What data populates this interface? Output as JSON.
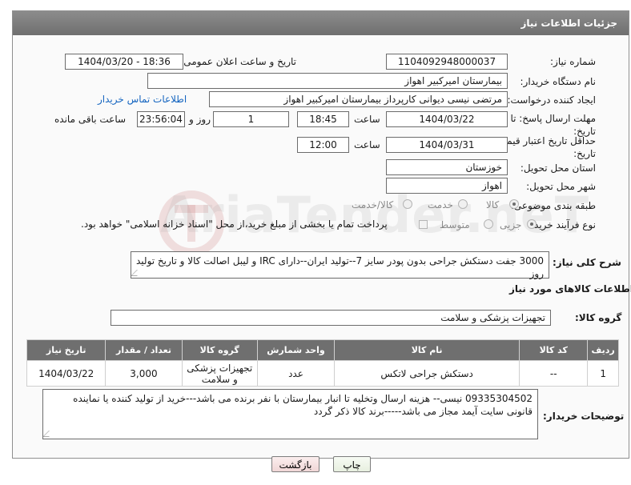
{
  "header": {
    "title": "جزئیات اطلاعات نیاز"
  },
  "watermark": {
    "text": "AriaTender.neT"
  },
  "fields": {
    "need_number": {
      "label": "شماره نیاز:",
      "value": "1104092948000037"
    },
    "announce_datetime": {
      "label": "تاریخ و ساعت اعلان عمومی:",
      "value": "1404/03/20 - 18:36"
    },
    "buyer_org": {
      "label": "نام دستگاه خریدار:",
      "value": "بیمارستان امیرکبیر اهواز"
    },
    "requester": {
      "label": "ایجاد کننده درخواست:",
      "value": "مرتضی نیسی دیوانی کارپرداز بیمارستان امیرکبیر اهواز",
      "contact_link": "اطلاعات تماس خریدار"
    },
    "reply_deadline": {
      "label": "مهلت ارسال پاسخ: تا تاریخ:",
      "date": "1404/03/22",
      "time_label": "ساعت",
      "time": "18:45",
      "days": "1",
      "days_label": "روز و",
      "remaining": "23:56:04",
      "remaining_label": "ساعت باقی مانده"
    },
    "price_validity": {
      "label": "حداقل تاریخ اعتبار قیمت: تا تاریخ:",
      "date": "1404/03/31",
      "time_label": "ساعت",
      "time": "12:00"
    },
    "delivery_province": {
      "label": "استان محل تحویل:",
      "value": "خوزستان"
    },
    "delivery_city": {
      "label": "شهر محل تحویل:",
      "value": "اهواز"
    },
    "category": {
      "label": "طبقه بندی موضوعی:",
      "options": [
        "کالا",
        "خدمت",
        "کالا/خدمت"
      ],
      "selected": "کالا"
    },
    "purchase_process": {
      "label": "نوع فرآیند خرید :",
      "options": [
        "جزیی",
        "متوسط"
      ],
      "selected": "جزیی",
      "note": "پرداخت تمام یا بخشی از مبلغ خرید،از محل \"اسناد خزانه اسلامی\" خواهد بود."
    }
  },
  "description": {
    "label": "شرح کلی نیاز:",
    "value": "3000 جفت دستکش جراحی بدون پودر سایز 7--تولید ایران--دارای IRC و لیبل اصالت کالا و تاریخ تولید روز"
  },
  "goods_section": {
    "title": "اطلاعات کالاهای مورد نیاز",
    "group_label": "گروه کالا:",
    "group_value": "تجهیزات پزشکی و سلامت"
  },
  "table": {
    "headers": [
      "ردیف",
      "کد کالا",
      "نام کالا",
      "واحد شمارش",
      "گروه کالا",
      "تعداد / مقدار",
      "تاریخ نیاز"
    ],
    "rows": [
      [
        "1",
        "--",
        "دستکش جراحی لاتکس",
        "عدد",
        "تجهیزات پزشکی و سلامت",
        "3,000",
        "1404/03/22"
      ]
    ]
  },
  "buyer_notes": {
    "label": "توضیحات خریدار:",
    "value": "09335304502 نیسی-- هزینه ارسال وتخلیه تا انبار بیمارستان با نفر برنده می باشد---خرید از تولید کننده یا نماینده قانونی سایت آیمد مجاز می باشد-----برند کالا ذکر گردد"
  },
  "buttons": {
    "print": "چاپ",
    "back": "بازگشت"
  }
}
